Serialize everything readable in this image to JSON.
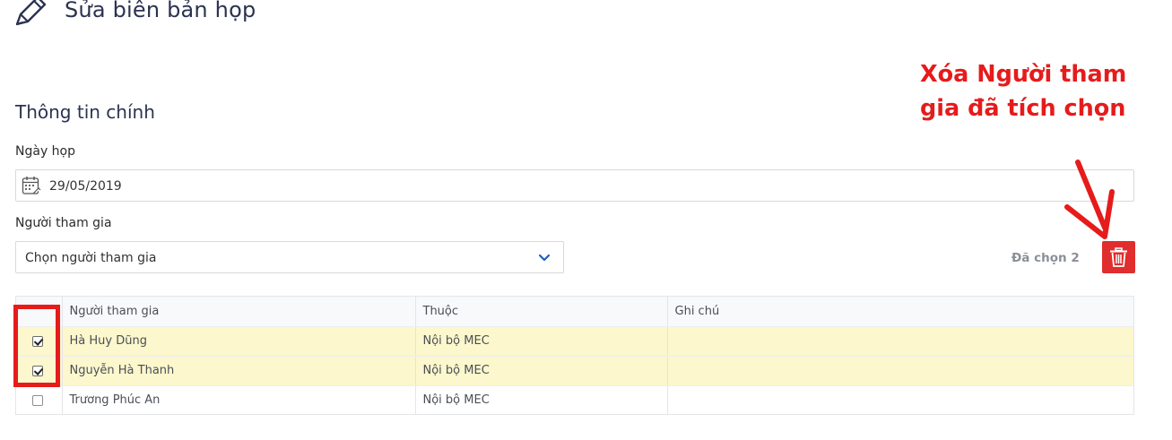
{
  "header": {
    "title": "Sửa biên bản họp",
    "icon": "pencil-icon"
  },
  "section": {
    "title": "Thông tin chính"
  },
  "date_field": {
    "label": "Ngày họp",
    "value": "29/05/2019",
    "icon": "calendar-icon"
  },
  "participants_field": {
    "label": "Người tham gia",
    "placeholder": "Chọn người tham gia"
  },
  "selection": {
    "count_text": "Đã chọn 2",
    "delete_icon": "trash-icon",
    "delete_color": "#e02d2d"
  },
  "annotation": {
    "text": "Xóa Người tham gia đã tích chọn",
    "color": "#e61b1b"
  },
  "table": {
    "headers": [
      "",
      "Người tham gia",
      "Thuộc",
      "Ghi chú"
    ],
    "rows": [
      {
        "checked": true,
        "name": "Hà Huy Dũng",
        "org": "Nội bộ MEC",
        "note": ""
      },
      {
        "checked": true,
        "name": "Nguyễn Hà Thanh",
        "org": "Nội bộ MEC",
        "note": ""
      },
      {
        "checked": false,
        "name": "Trương Phúc An",
        "org": "Nội bộ MEC",
        "note": ""
      }
    ],
    "selected_row_color": "#fcf7cc"
  }
}
